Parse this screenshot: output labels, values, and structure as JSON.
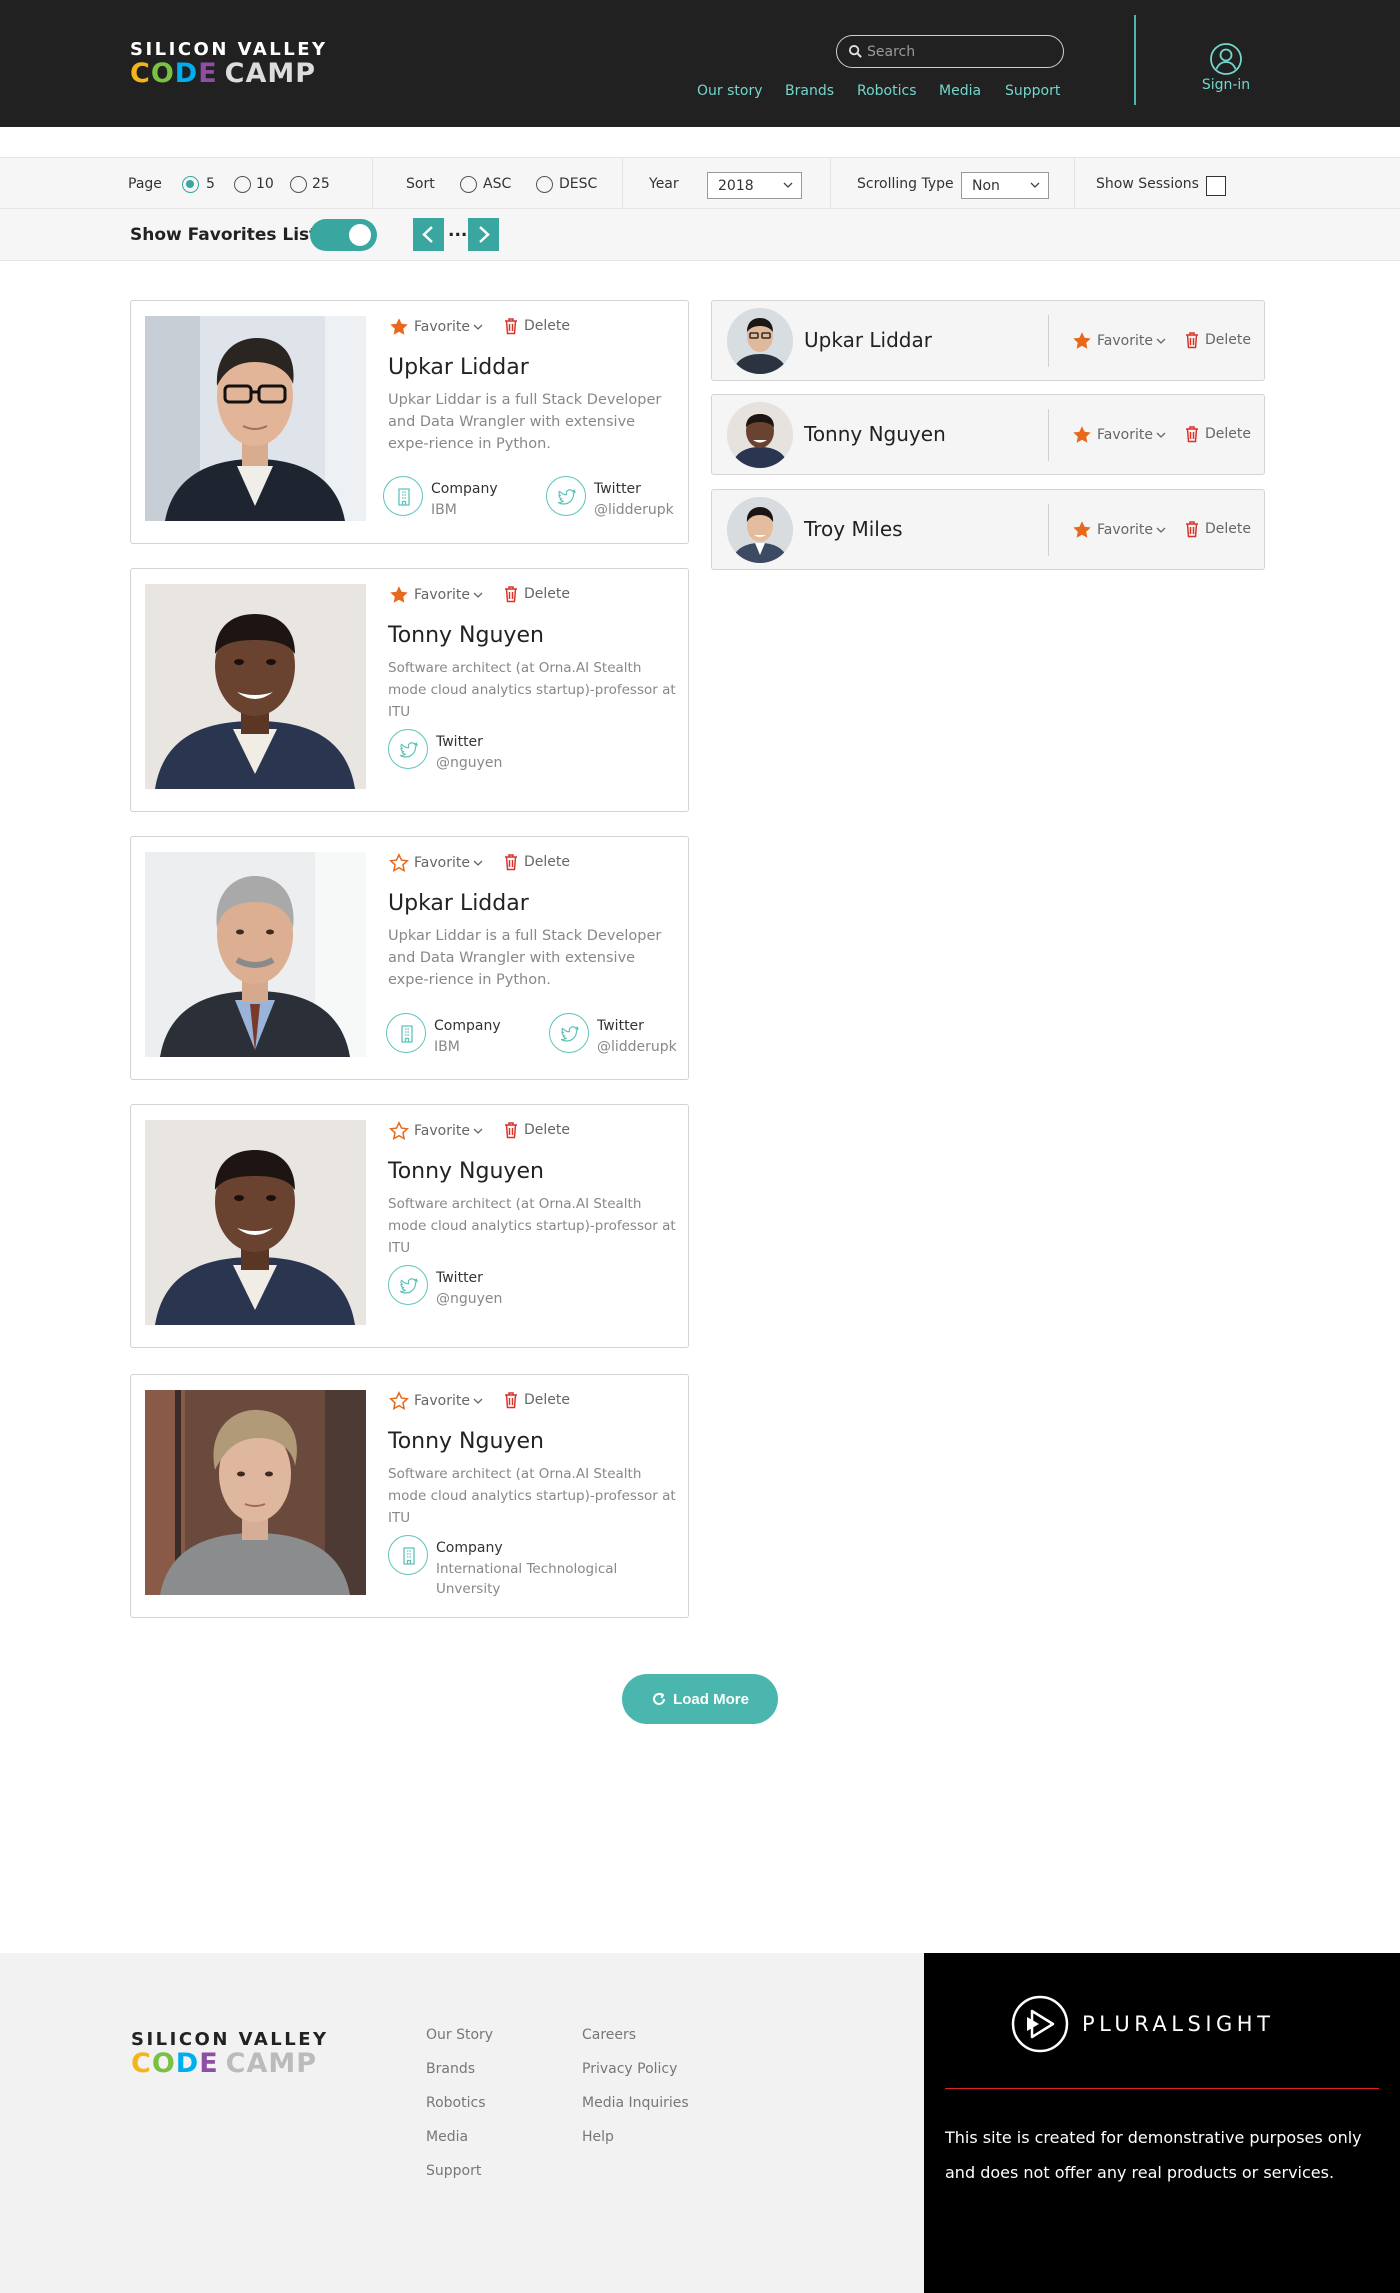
{
  "header": {
    "logo_line1": "SILICON VALLEY",
    "logo_code": [
      "C",
      "O",
      "D",
      "E"
    ],
    "logo_camp": "CAMP",
    "search_placeholder": "Search",
    "nav": [
      "Our story",
      "Brands",
      "Robotics",
      "Media",
      "Support"
    ],
    "signin": "Sign-in"
  },
  "filters": {
    "page_label": "Page",
    "page_options": [
      "5",
      "10",
      "25"
    ],
    "page_selected": "5",
    "sort_label": "Sort",
    "sort_options": [
      "ASC",
      "DESC"
    ],
    "year_label": "Year",
    "year_value": "2018",
    "scrolling_label": "Scrolling Type",
    "scrolling_value": "Non",
    "show_sessions_label": "Show Sessions",
    "show_sessions_checked": false
  },
  "favorites_bar": {
    "label": "Show Favorites List",
    "toggle_on": true,
    "pager_ellipsis": "..."
  },
  "actions": {
    "favorite": "Favorite",
    "delete": "Delete"
  },
  "speakers": [
    {
      "name": "Upkar Liddar",
      "bio": "Upkar Liddar is a full Stack Developer and Data Wrangler with extensive expe-rience in Python.",
      "favorited": true,
      "company_label": "Company",
      "company": "IBM",
      "twitter_label": "Twitter",
      "twitter": "@lidderupk"
    },
    {
      "name": "Tonny Nguyen",
      "bio": "Software architect (at Orna.AI Stealth mode cloud analytics startup)-professor at ITU",
      "favorited": true,
      "twitter_label": "Twitter",
      "twitter": "@nguyen"
    },
    {
      "name": "Upkar Liddar",
      "bio": "Upkar Liddar is a full Stack Developer and Data Wrangler with extensive expe-rience in Python.",
      "favorited": false,
      "company_label": "Company",
      "company": "IBM",
      "twitter_label": "Twitter",
      "twitter": "@lidderupk"
    },
    {
      "name": "Tonny Nguyen",
      "bio": "Software architect (at Orna.AI Stealth mode cloud analytics startup)-professor at ITU",
      "favorited": false,
      "twitter_label": "Twitter",
      "twitter": "@nguyen"
    },
    {
      "name": "Tonny Nguyen",
      "bio": "Software architect (at Orna.AI Stealth mode cloud analytics startup)-professor at ITU",
      "favorited": false,
      "company_label": "Company",
      "company": "International Technological Unversity"
    }
  ],
  "favorites_list": [
    {
      "name": "Upkar Liddar"
    },
    {
      "name": "Tonny Nguyen"
    },
    {
      "name": "Troy Miles"
    }
  ],
  "load_more": "Load More",
  "footer": {
    "logo_line1": "SILICON VALLEY",
    "logo_camp": "CAMP",
    "col1": [
      "Our Story",
      "Brands",
      "Robotics",
      "Media",
      "Support"
    ],
    "col2": [
      "Careers",
      "Privacy Policy",
      "Media Inquiries",
      "Help"
    ],
    "pluralsight": "PLURALSIGHT",
    "disclaimer": "This site is created for demonstrative purposes only and does not offer any real products or services."
  },
  "colors": {
    "accent": "#3aa6a0",
    "nav_text": "#74d6cc",
    "favorite_orange": "#e8681c",
    "delete_red": "#d9342b",
    "header_bg": "#212121",
    "code_c": "#f3b51b",
    "code_o": "#7ac143",
    "code_d": "#00aeef",
    "code_e": "#8d4fa3"
  },
  "icons": [
    "search-icon",
    "user-icon",
    "chevron-left-icon",
    "chevron-right-icon",
    "star-icon",
    "trash-icon",
    "building-icon",
    "twitter-icon",
    "refresh-icon",
    "pluralsight-play-icon"
  ]
}
